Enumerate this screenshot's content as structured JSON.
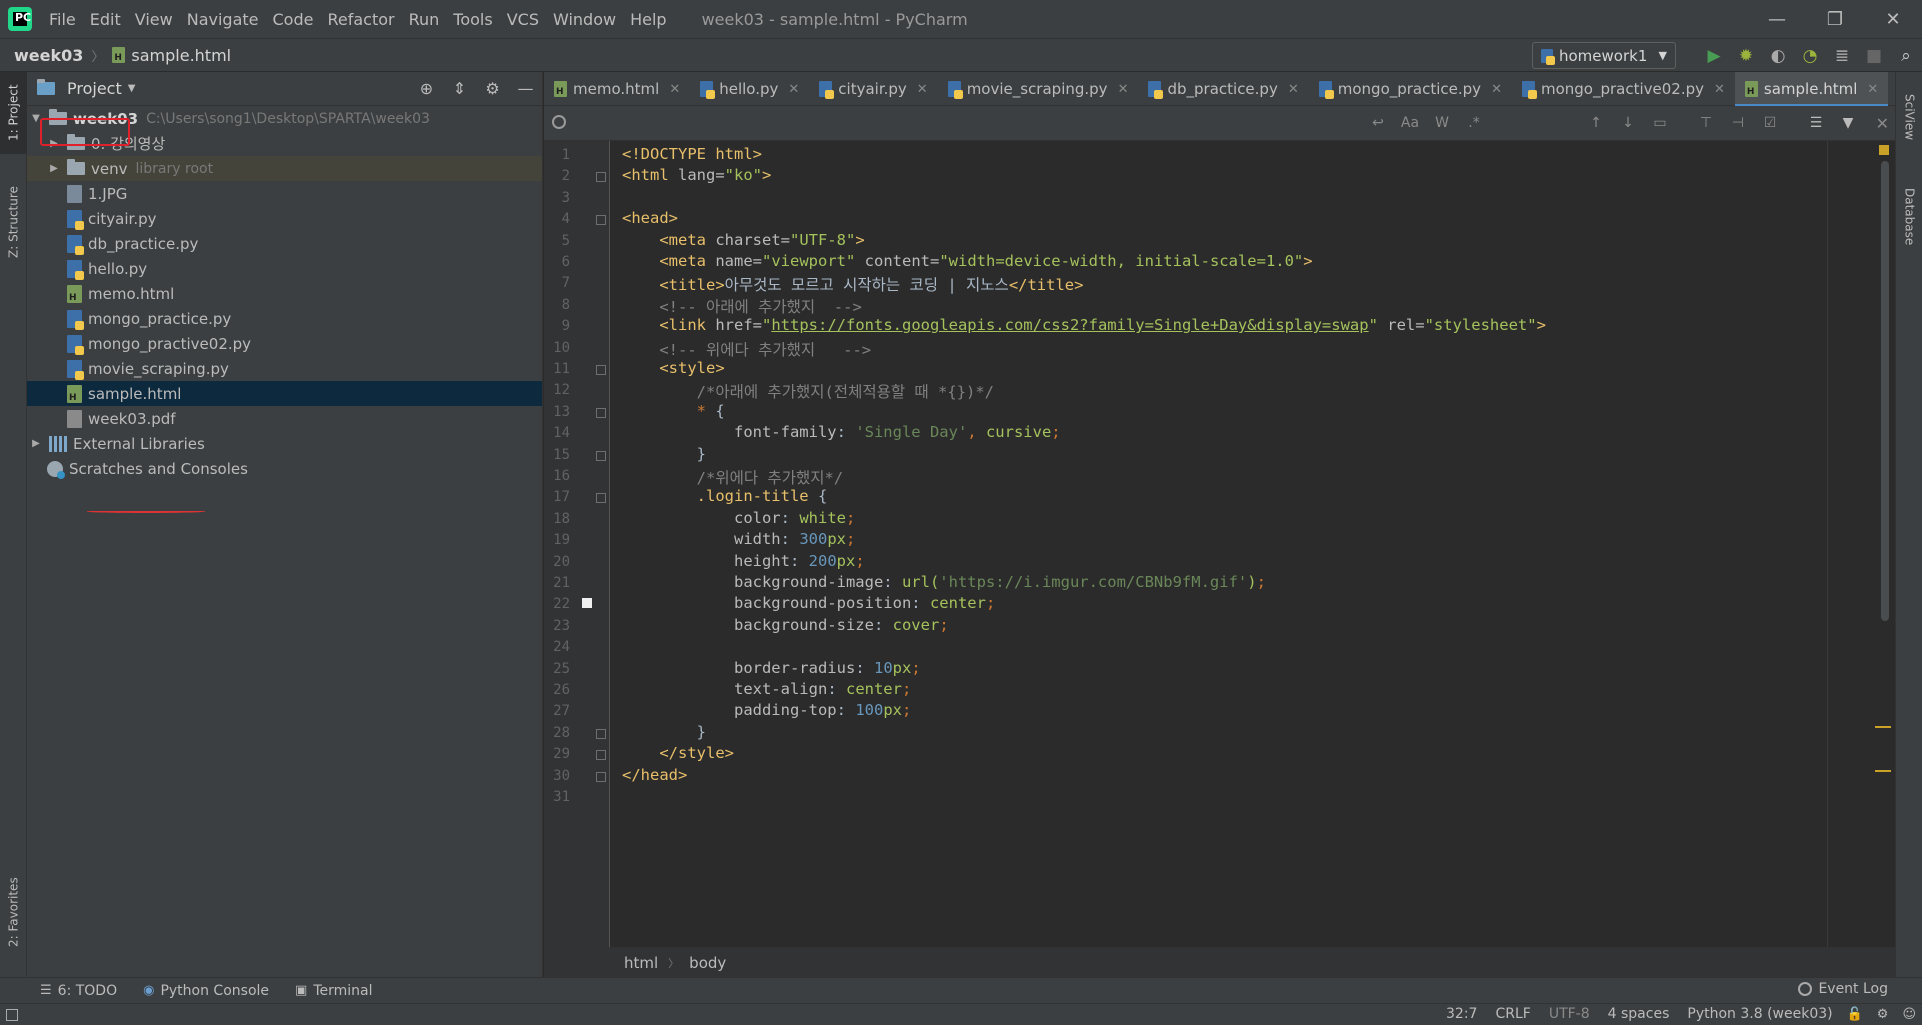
{
  "app": {
    "window_title": "week03 - sample.html - PyCharm",
    "menu": [
      "File",
      "Edit",
      "View",
      "Navigate",
      "Code",
      "Refactor",
      "Run",
      "Tools",
      "VCS",
      "Window",
      "Help"
    ]
  },
  "navbar": {
    "project": "week03",
    "file": "sample.html",
    "run_config": "homework1"
  },
  "left_stripe": {
    "project_tab": "1: Project",
    "structure_tab": "Z: Structure",
    "favorites_tab": "2: Favorites"
  },
  "right_stripe": {
    "sciview_tab": "SciView",
    "database_tab": "Database"
  },
  "project_panel": {
    "title": "Project",
    "root_name": "week03",
    "root_path": "C:\\Users\\song1\\Desktop\\SPARTA\\week03",
    "items": [
      {
        "label": "0. 강의영상",
        "type": "folder"
      },
      {
        "label": "venv",
        "type": "folder",
        "note": "library root"
      },
      {
        "label": "1.JPG",
        "type": "jpg"
      },
      {
        "label": "cityair.py",
        "type": "py"
      },
      {
        "label": "db_practice.py",
        "type": "py"
      },
      {
        "label": "hello.py",
        "type": "py"
      },
      {
        "label": "memo.html",
        "type": "html"
      },
      {
        "label": "mongo_practice.py",
        "type": "py"
      },
      {
        "label": "mongo_practive02.py",
        "type": "py"
      },
      {
        "label": "movie_scraping.py",
        "type": "py"
      },
      {
        "label": "sample.html",
        "type": "html"
      },
      {
        "label": "week03.pdf",
        "type": "pdf"
      }
    ],
    "external_libraries": "External Libraries",
    "scratches": "Scratches and Consoles"
  },
  "editor_tabs": [
    {
      "label": "memo.html",
      "type": "html"
    },
    {
      "label": "hello.py",
      "type": "py"
    },
    {
      "label": "cityair.py",
      "type": "py"
    },
    {
      "label": "movie_scraping.py",
      "type": "py"
    },
    {
      "label": "db_practice.py",
      "type": "py"
    },
    {
      "label": "mongo_practice.py",
      "type": "py"
    },
    {
      "label": "mongo_practive02.py",
      "type": "py"
    },
    {
      "label": "sample.html",
      "type": "html",
      "active": true
    }
  ],
  "findbar": {
    "query": "",
    "opt_case": "Aa",
    "opt_words": "W",
    "opt_regex": ".*"
  },
  "code_lines": [
    {
      "n": "1",
      "html": "<span class=\"c-tag\">&lt;!DOCTYPE html&gt;</span>"
    },
    {
      "n": "2",
      "html": "<span class=\"c-tag\">&lt;html </span><span class=\"c-attr\">lang=</span><span class=\"c-str\">\"ko\"</span><span class=\"c-tag\">&gt;</span>"
    },
    {
      "n": "3",
      "html": ""
    },
    {
      "n": "4",
      "html": "<span class=\"c-tag\">&lt;head&gt;</span>"
    },
    {
      "n": "5",
      "html": "    <span class=\"c-tag\">&lt;meta </span><span class=\"c-attr\">charset=</span><span class=\"c-str\">\"UTF-8\"</span><span class=\"c-tag\">&gt;</span>"
    },
    {
      "n": "6",
      "html": "    <span class=\"c-tag\">&lt;meta </span><span class=\"c-attr\">name=</span><span class=\"c-str\">\"viewport\"</span><span class=\"c-attr\"> content=</span><span class=\"c-str\">\"width=device-width, initial-scale=1.0\"</span><span class=\"c-tag\">&gt;</span>"
    },
    {
      "n": "7",
      "html": "    <span class=\"c-tag\">&lt;title&gt;</span>아무것도 모르고 시작하는 코딩 | 지노스<span class=\"c-tag\">&lt;/title&gt;</span>"
    },
    {
      "n": "8",
      "html": "    <span class=\"c-com\">&lt;!-- 아래에 추가했지  --&gt;</span>"
    },
    {
      "n": "9",
      "html": "    <span class=\"c-tag\">&lt;link </span><span class=\"c-attr\">href=</span><span class=\"c-str\">\"</span><span class=\"c-link\">https://fonts.googleapis.com/css2?family=Single+Day&amp;display=swap</span><span class=\"c-str\">\"</span><span class=\"c-attr\"> rel=</span><span class=\"c-str\">\"stylesheet\"</span><span class=\"c-tag\">&gt;</span>"
    },
    {
      "n": "10",
      "html": "    <span class=\"c-com\">&lt;!-- 위에다 추가했지   --&gt;</span>"
    },
    {
      "n": "11",
      "html": "    <span class=\"c-tag\">&lt;style&gt;</span>"
    },
    {
      "n": "12",
      "html": "        <span class=\"c-com\">/*아래에 추가했지(전체적용할 때 *{})*/</span>"
    },
    {
      "n": "13",
      "html": "        <span class=\"c-star\">*</span> {"
    },
    {
      "n": "14",
      "html": "            <span class=\"c-prop\">font-family</span>: <span class=\"c-fstr\">'Single Day'</span><span class=\"c-punc\">, </span><span class=\"c-val\">cursive</span><span class=\"c-punc\">;</span>"
    },
    {
      "n": "15",
      "html": "        }"
    },
    {
      "n": "16",
      "html": "        <span class=\"c-com\">/*위에다 추가했지*/</span>"
    },
    {
      "n": "17",
      "html": "        <span class=\"c-sel\">.login-title</span> {"
    },
    {
      "n": "18",
      "html": "            <span class=\"c-prop\">color</span>: <span class=\"c-val\">white</span><span class=\"c-punc\">;</span>"
    },
    {
      "n": "19",
      "html": "            <span class=\"c-prop\">width</span>: <span class=\"c-num\">300</span><span class=\"c-val\">px</span><span class=\"c-punc\">;</span>"
    },
    {
      "n": "20",
      "html": "            <span class=\"c-prop\">height</span>: <span class=\"c-num\">200</span><span class=\"c-val\">px</span><span class=\"c-punc\">;</span>"
    },
    {
      "n": "21",
      "html": "            <span class=\"c-prop\">background-image</span>: <span class=\"c-val\">url(</span><span class=\"c-fstr\">'https://i.imgur.com/CBNb9fM.gif'</span><span class=\"c-val\">)</span><span class=\"c-punc\">;</span>"
    },
    {
      "n": "22",
      "html": "            <span class=\"c-prop\">background-position</span>: <span class=\"c-val\">center</span><span class=\"c-punc\">;</span>"
    },
    {
      "n": "23",
      "html": "            <span class=\"c-prop\">background-size</span>: <span class=\"c-val\">cover</span><span class=\"c-punc\">;</span>"
    },
    {
      "n": "24",
      "html": ""
    },
    {
      "n": "25",
      "html": "            <span class=\"c-prop\">border-radius</span>: <span class=\"c-num\">10</span><span class=\"c-val\">px</span><span class=\"c-punc\">;</span>"
    },
    {
      "n": "26",
      "html": "            <span class=\"c-prop\">text-align</span>: <span class=\"c-val\">center</span><span class=\"c-punc\">;</span>"
    },
    {
      "n": "27",
      "html": "            <span class=\"c-prop\">padding-top</span>: <span class=\"c-num\">100</span><span class=\"c-val\">px</span><span class=\"c-punc\">;</span>"
    },
    {
      "n": "28",
      "html": "        }"
    },
    {
      "n": "29",
      "html": "    <span class=\"c-tag\">&lt;/style&gt;</span>"
    },
    {
      "n": "30",
      "html": "<span class=\"c-tag\">&lt;/head&gt;</span>"
    },
    {
      "n": "31",
      "html": ""
    }
  ],
  "fold_lines": [
    2,
    4,
    11,
    13,
    15,
    17,
    28,
    29,
    30
  ],
  "editor_breadcrumbs": [
    "html",
    "body"
  ],
  "bottom_bar": {
    "todo": "6: TODO",
    "python_console": "Python Console",
    "terminal": "Terminal",
    "event_log": "Event Log"
  },
  "statusbar": {
    "position": "32:7",
    "line_sep": "CRLF",
    "encoding": "UTF-8",
    "indent": "4 spaces",
    "interpreter": "Python 3.8 (week03)"
  }
}
